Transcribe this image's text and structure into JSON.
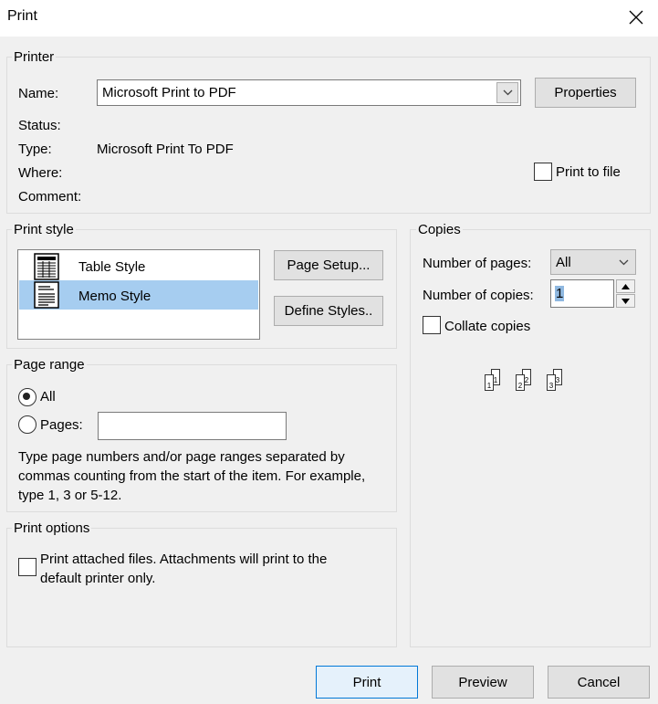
{
  "dialog": {
    "title": "Print"
  },
  "printer": {
    "legend": "Printer",
    "name_label": "Name:",
    "name_value": "Microsoft Print to PDF",
    "properties_label": "Properties",
    "status_label": "Status:",
    "type_label": "Type:",
    "type_value": "Microsoft Print To PDF",
    "where_label": "Where:",
    "comment_label": "Comment:",
    "print_to_file_label": "Print to file"
  },
  "print_style": {
    "legend": "Print style",
    "items": [
      {
        "label": "Table Style",
        "icon": "table-style-icon",
        "selected": false
      },
      {
        "label": "Memo Style",
        "icon": "memo-style-icon",
        "selected": true
      }
    ],
    "page_setup_label": "Page Setup...",
    "define_styles_label": "Define Styles.."
  },
  "copies": {
    "legend": "Copies",
    "pages_label": "Number of pages:",
    "pages_value": "All",
    "copies_label": "Number of copies:",
    "copies_value": "1",
    "collate_label": "Collate copies",
    "collate_icon_numbers": [
      "1",
      "1",
      "2",
      "2",
      "3",
      "3"
    ]
  },
  "page_range": {
    "legend": "Page range",
    "all_label": "All",
    "pages_label": "Pages:",
    "pages_value": "",
    "help_line1": "Type page numbers and/or page ranges separated by",
    "help_line2": "commas counting from the start of the item.  For example,",
    "help_line3": "type 1, 3 or 5-12."
  },
  "print_options": {
    "legend": "Print options",
    "attach_line1": "Print attached files.  Attachments will print to the",
    "attach_line2": "default printer only."
  },
  "footer": {
    "print_label": "Print",
    "preview_label": "Preview",
    "cancel_label": "Cancel"
  }
}
